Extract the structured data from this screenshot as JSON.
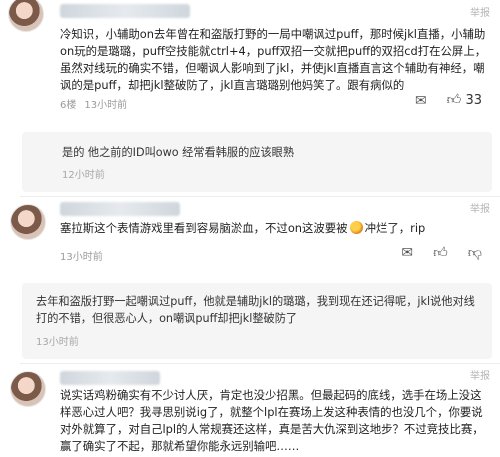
{
  "report_label": "举报",
  "comment1": {
    "content": "冷知识，小辅助on去年曾在和盗版打野的一局中嘲讽过puff，那时候jkl直播，小辅助on玩的是璐璐，puff空技能就ctrl+4，puff双招一交就把puff的双招cd打在公屏上，虽然对线玩的确实不错，但嘲讽人影响到了jkl，并使jkl直播直言这个辅助有神经，嘲讽的是puff，却把jkl整破防了，jkl直言璐璐别他妈笑了。跟有病似的",
    "floor": "6楼",
    "time": "13小时前",
    "likes": "33"
  },
  "reply1": {
    "text": "是的 他之前的ID叫owo 经常看韩服的应该眼熟",
    "time": "12小时前"
  },
  "comment2": {
    "content_before": "塞拉斯这个表情游戏里看到容易脑淤血，不过on这波要被",
    "content_after": "冲烂了，rip",
    "time": "13小时前"
  },
  "reply2": {
    "text": "去年和盗版打野一起嘲讽过puff，他就是辅助jkl的璐璐，我到现在还记得呢，jkl说他对线打的不错，但很恶心人，on嘲讽puff却把jkl整破防了",
    "time": "13小时前"
  },
  "comment3": {
    "content": "说实话鸡粉确实有不少讨人厌，肯定也没少招黑。但最起码的底线，选手在场上没这样恶心过人吧？我寻思别说ig了，就整个lpl在赛场上发这种表情的也没几个，你要说对外就算了，对自己lpl的人常规赛还这样，真是苦大仇深到这地步？不过竞技比赛，赢了确实了不起，那就希望你能永远别输吧……"
  },
  "icons": [
    "avatar",
    "comment-icon",
    "thumbs-up-icon",
    "thumbs-down-icon",
    "emoji-icon"
  ]
}
